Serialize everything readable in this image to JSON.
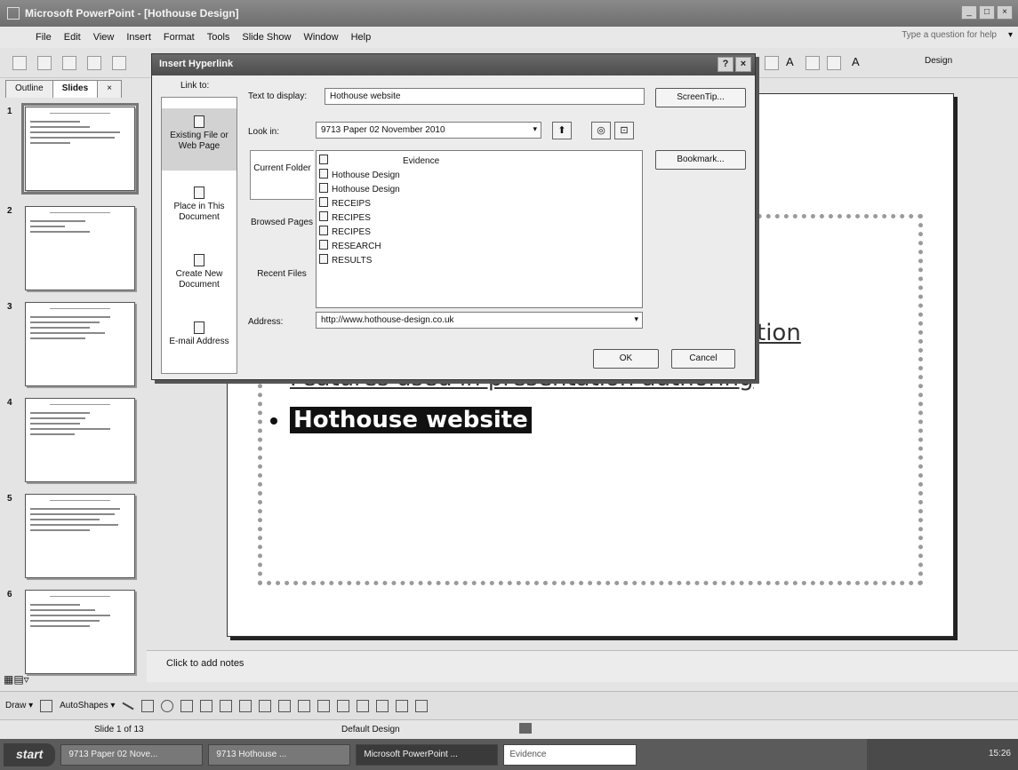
{
  "window": {
    "title": "Microsoft PowerPoint - [Hothouse Design]",
    "controls": [
      "_",
      "□",
      "×"
    ]
  },
  "menu": {
    "items": [
      "File",
      "Edit",
      "View",
      "Insert",
      "Format",
      "Tools",
      "Slide Show",
      "Window",
      "Help"
    ],
    "help_box": "Type a question for help",
    "help_arrow": "▾"
  },
  "toolbar": {
    "design_label": "Design",
    "font_size_glyph": "A"
  },
  "panel": {
    "tabs": [
      "Outline",
      "Slides"
    ],
    "close": "×",
    "slide_numbers": [
      "1",
      "2",
      "3",
      "4",
      "5",
      "6"
    ]
  },
  "slide": {
    "bullets": [
      {
        "text": "tion"
      },
      {
        "text": "Features used in presentation authoring"
      },
      {
        "text": "Hothouse website"
      }
    ]
  },
  "notes": {
    "placeholder": "Click to add notes"
  },
  "view_buttons": "▦▤▿",
  "drawbar": {
    "draw_label": "Draw ▾",
    "autoshapes_label": "AutoShapes ▾"
  },
  "status": {
    "slide_info": "Slide 1 of 13",
    "design": "Default Design"
  },
  "taskbar": {
    "start": "start",
    "items": [
      "9713 Paper 02 Nove...",
      "9713 Hothouse ...",
      "Microsoft PowerPoint ..."
    ],
    "small_item": "Evidence",
    "clock": "15:26"
  },
  "dialog": {
    "title": "Insert Hyperlink",
    "controls": [
      "?",
      "×"
    ],
    "link_to_label": "Link to:",
    "link_to_items": [
      {
        "label": "Existing File or Web Page"
      },
      {
        "label": "Place in This Document"
      },
      {
        "label": "Create New Document"
      },
      {
        "label": "E-mail Address"
      }
    ],
    "text_to_display_label": "Text to display:",
    "text_to_display_value": "Hothouse website",
    "screentip_button": "ScreenTip...",
    "look_in_label": "Look in:",
    "look_in_value": "9713 Paper 02 November 2010",
    "look_in_arrow": "▾",
    "side_tabs": [
      "Current Folder",
      "Browsed Pages",
      "Recent Files"
    ],
    "files": [
      "Evidence",
      "Hothouse Design",
      "Hothouse Design",
      "RECEIPS",
      "RECIPES",
      "RECIPES",
      "RESEARCH",
      "RESULTS"
    ],
    "bookmark_button": "Bookmark...",
    "address_label": "Address:",
    "address_value": "http://www.hothouse-design.co.uk",
    "address_arrow": "▾",
    "ok_button": "OK",
    "cancel_button": "Cancel",
    "icon_glyphs": [
      "⬆",
      "◎",
      "⊡"
    ]
  }
}
